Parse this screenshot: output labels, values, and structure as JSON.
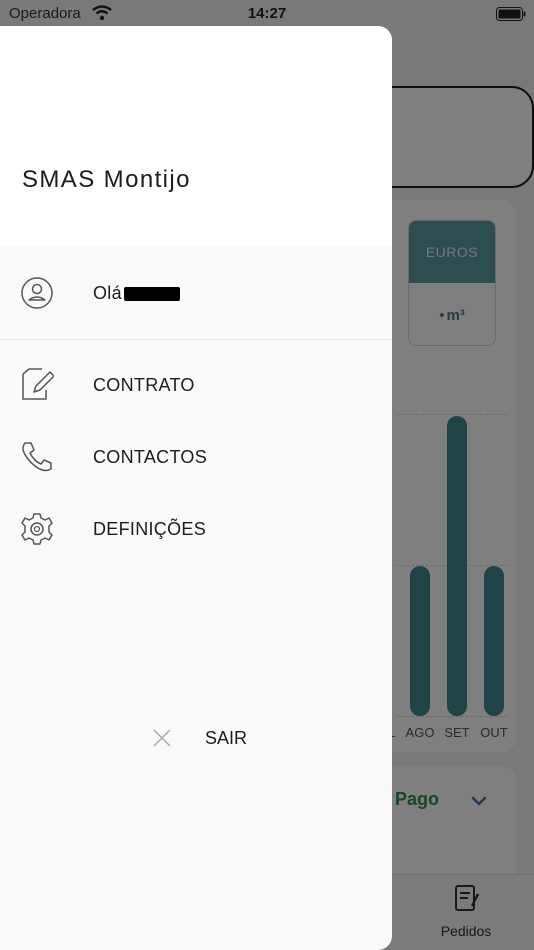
{
  "status_bar": {
    "carrier": "Operadora",
    "time": "14:27"
  },
  "drawer": {
    "title": "SMAS Montijo",
    "greeting": "Olá",
    "menu": [
      {
        "label": "CONTRATO",
        "icon": "edit-document-icon"
      },
      {
        "label": "CONTACTOS",
        "icon": "phone-icon"
      },
      {
        "label": "DEFINIÇÕES",
        "icon": "gear-icon"
      }
    ],
    "logout_label": "SAIR"
  },
  "background": {
    "toggle_euros": "EUROS",
    "toggle_m3": "m³",
    "status_text": "Pago",
    "tab_label": "Pedidos",
    "accent": "#3f8891",
    "chart_data": {
      "type": "bar",
      "categories": [
        "L",
        "AGO",
        "SET",
        "OUT"
      ],
      "values": [
        0,
        1,
        2,
        1
      ],
      "xlabel": "",
      "ylabel": ""
    }
  }
}
